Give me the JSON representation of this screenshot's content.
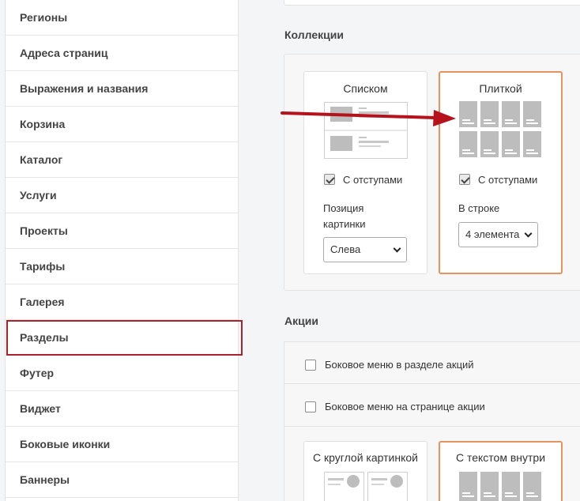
{
  "sidebar": {
    "items": [
      {
        "label": "Регионы",
        "active": false
      },
      {
        "label": "Адреса страниц",
        "active": false
      },
      {
        "label": "Выражения и названия",
        "active": false
      },
      {
        "label": "Корзина",
        "active": false
      },
      {
        "label": "Каталог",
        "active": false
      },
      {
        "label": "Услуги",
        "active": false
      },
      {
        "label": "Проекты",
        "active": false
      },
      {
        "label": "Тарифы",
        "active": false
      },
      {
        "label": "Галерея",
        "active": false
      },
      {
        "label": "Разделы",
        "active": true
      },
      {
        "label": "Футер",
        "active": false
      },
      {
        "label": "Виджет",
        "active": false
      },
      {
        "label": "Боковые иконки",
        "active": false
      },
      {
        "label": "Баннеры",
        "active": false
      }
    ]
  },
  "collections": {
    "title": "Коллекции",
    "list_card": {
      "title": "Списком",
      "padding_label": "С отступами",
      "padding_checked": true,
      "position_label": "Позиция картинки",
      "position_value": "Слева"
    },
    "tile_card": {
      "title": "Плиткой",
      "padding_label": "С отступами",
      "padding_checked": true,
      "per_row_label": "В строке",
      "per_row_value": "4 элемента"
    }
  },
  "actions": {
    "title": "Акции",
    "sidebar_in_section_label": "Боковое меню в разделе акций",
    "sidebar_in_section_checked": false,
    "sidebar_on_page_label": "Боковое меню на странице акции",
    "sidebar_on_page_checked": false,
    "round_image_card_title": "С круглой картинкой",
    "text_inside_card_title": "С текстом внутри"
  },
  "colors": {
    "active_border": "#a8232b",
    "selected_card_border": "#e8925f",
    "arrow": "#b5121b"
  }
}
